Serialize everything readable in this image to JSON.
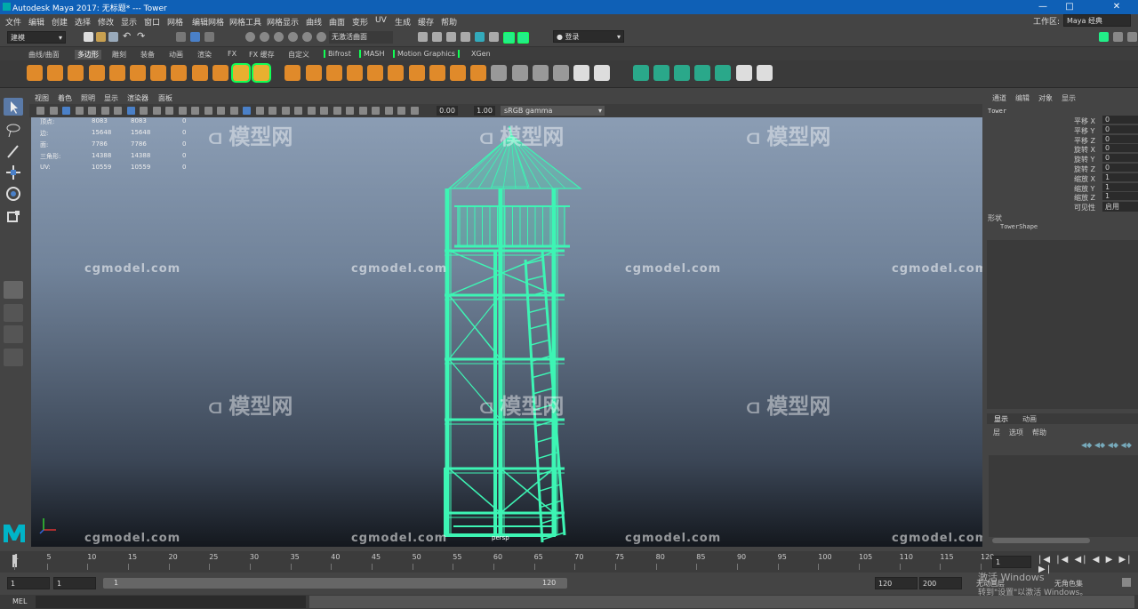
{
  "window": {
    "title": "Autodesk Maya 2017: 无标题*   ---   Tower",
    "controls": [
      "—",
      "□",
      "✕"
    ]
  },
  "menubar": {
    "items": [
      "文件",
      "编辑",
      "创建",
      "选择",
      "修改",
      "显示",
      "窗口",
      "网格",
      "编辑网格",
      "网格工具",
      "网格显示",
      "曲线",
      "曲面",
      "变形",
      "UV",
      "生成",
      "缓存",
      "帮助"
    ]
  },
  "statusline": {
    "mode": "建模",
    "no_live_surface": "无激活曲面",
    "signin": "登录",
    "workspace_label": "工作区:",
    "workspace_value": "Maya 经典"
  },
  "shelf_tabs": [
    "曲线/曲面",
    "多边形",
    "雕刻",
    "装备",
    "动画",
    "渲染",
    "FX",
    "FX 缓存",
    "自定义",
    "Bifrost",
    "MASH",
    "Motion Graphics",
    "XGen"
  ],
  "shelf_icons": [
    "sphere-icon",
    "cube-icon",
    "cylinder-icon",
    "cone-icon",
    "plane-icon",
    "torus-icon",
    "prism-icon",
    "pyramid-icon",
    "pipe-icon",
    "helix-icon",
    "text-icon",
    "svg-icon",
    "combine-icon",
    "separate-icon",
    "smooth-icon",
    "mirror-icon",
    "extract-icon",
    "boolean-icon",
    "bridge-icon",
    "extrude-icon",
    "bevel-icon",
    "append-icon",
    "fill-hole-icon",
    "multicut-icon",
    "target-weld-icon",
    "connect-icon",
    "collapse-icon",
    "merge-icon",
    "planar-uv-icon",
    "cylindrical-uv-icon",
    "spherical-uv-icon",
    "auto-uv-icon",
    "layout-uv-icon",
    "checker-icon",
    "delete-history-icon"
  ],
  "panel_menu": [
    "视图",
    "着色",
    "照明",
    "显示",
    "渲染器",
    "面板"
  ],
  "panel_toolbar": {
    "exposure": "0.00",
    "gamma": "1.00",
    "colorspace": "sRGB gamma"
  },
  "hud": {
    "rows": [
      {
        "label": "顶点:",
        "a": "8083",
        "b": "8083",
        "c": "0"
      },
      {
        "label": "边:",
        "a": "15648",
        "b": "15648",
        "c": "0"
      },
      {
        "label": "面:",
        "a": "7786",
        "b": "7786",
        "c": "0"
      },
      {
        "label": "三角形:",
        "a": "14388",
        "b": "14388",
        "c": "0"
      },
      {
        "label": "UV:",
        "a": "10559",
        "b": "10559",
        "c": "0"
      }
    ],
    "camera": "persp"
  },
  "watermarks": {
    "site": "cgmodel.com",
    "brand": "模型网"
  },
  "channel_box": {
    "menu": [
      "通道",
      "编辑",
      "对象",
      "显示"
    ],
    "object_name": "Tower",
    "attrs": [
      {
        "label": "平移 X",
        "value": "0"
      },
      {
        "label": "平移 Y",
        "value": "0"
      },
      {
        "label": "平移 Z",
        "value": "0"
      },
      {
        "label": "旋转 X",
        "value": "0"
      },
      {
        "label": "旋转 Y",
        "value": "0"
      },
      {
        "label": "旋转 Z",
        "value": "0"
      },
      {
        "label": "缩放 X",
        "value": "1"
      },
      {
        "label": "缩放 Y",
        "value": "1"
      },
      {
        "label": "缩放 Z",
        "value": "1"
      },
      {
        "label": "可见性",
        "value": "启用"
      }
    ],
    "shapes_header": "形状",
    "shape_name": "TowerShape"
  },
  "layer_editor": {
    "tabs": [
      "显示",
      "动画"
    ],
    "menu": [
      "层",
      "选项",
      "帮助"
    ]
  },
  "timeline": {
    "ticks": [
      "1",
      "5",
      "10",
      "15",
      "20",
      "25",
      "30",
      "35",
      "40",
      "45",
      "50",
      "55",
      "60",
      "65",
      "70",
      "75",
      "80",
      "85",
      "90",
      "95",
      "100",
      "105",
      "110",
      "115",
      "120"
    ],
    "current_frame": "1"
  },
  "range": {
    "start": "1",
    "anim_start": "1",
    "slider_start": "1",
    "slider_end": "120",
    "end": "120",
    "anim_end": "200",
    "no_char_set": "无角色集",
    "no_anim_layer": "无动画层"
  },
  "activation": {
    "line1": "激活 Windows",
    "line2": "转到\"设置\"以激活 Windows。"
  },
  "cmdline": {
    "label": "MEL"
  },
  "colors": {
    "wireframe": "#3df5b4",
    "title_bar": "#0f60b6",
    "maya_logo": "#00b4c8"
  }
}
